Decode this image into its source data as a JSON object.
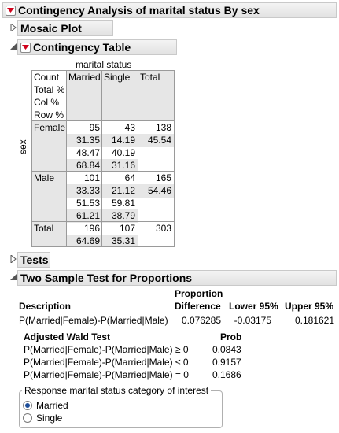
{
  "report": {
    "title": "Contingency Analysis of marital status By sex",
    "mosaic_title": "Mosaic Plot",
    "contingency_title": "Contingency Table",
    "tests_title": "Tests",
    "twosample_title": "Two Sample Test for Proportions"
  },
  "table": {
    "col_var": "marital status",
    "row_var": "sex",
    "legend": [
      "Count",
      "Total %",
      "Col %",
      "Row %"
    ],
    "col_headers": [
      "Married",
      "Single",
      "Total"
    ],
    "rows": [
      {
        "label": "Female",
        "married": [
          "95",
          "31.35",
          "48.47",
          "68.84"
        ],
        "single": [
          "43",
          "14.19",
          "40.19",
          "31.16"
        ],
        "total": [
          "138",
          "45.54"
        ]
      },
      {
        "label": "Male",
        "married": [
          "101",
          "33.33",
          "51.53",
          "61.21"
        ],
        "single": [
          "64",
          "21.12",
          "59.81",
          "38.79"
        ],
        "total": [
          "165",
          "54.46"
        ]
      }
    ],
    "total_row": {
      "label": "Total",
      "married": [
        "196",
        "64.69"
      ],
      "single": [
        "107",
        "35.31"
      ],
      "total": [
        "303"
      ]
    }
  },
  "twosample": {
    "headers": {
      "description": "Description",
      "proportion_line1": "Proportion",
      "proportion_line2": "Difference",
      "lower": "Lower 95%",
      "upper": "Upper 95%"
    },
    "row": {
      "description": "P(Married|Female)-P(Married|Male)",
      "difference": "0.076285",
      "lower": "-0.03175",
      "upper": "0.181621"
    },
    "wald_title": "Adjusted Wald Test",
    "prob_header": "Prob",
    "wald_rows": [
      {
        "test": "P(Married|Female)-P(Married|Male) ≥ 0",
        "prob": "0.0843"
      },
      {
        "test": "P(Married|Female)-P(Married|Male) ≤ 0",
        "prob": "0.9157"
      },
      {
        "test": "P(Married|Female)-P(Married|Male) = 0",
        "prob": "0.1686"
      }
    ],
    "response_group": {
      "legend": "Response marital status category of interest",
      "options": [
        {
          "label": "Married",
          "selected": true
        },
        {
          "label": "Single",
          "selected": false
        }
      ]
    }
  }
}
